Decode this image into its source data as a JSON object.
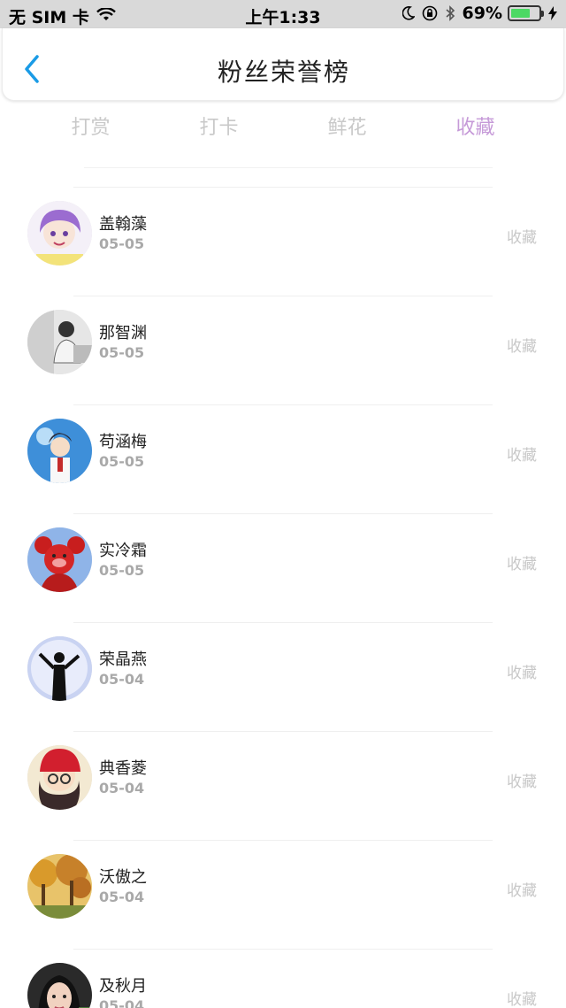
{
  "status_bar": {
    "carrier": "无 SIM 卡",
    "time": "上午1:33",
    "battery": "69%",
    "battery_level": 0.69
  },
  "header": {
    "title": "粉丝荣誉榜"
  },
  "tabs": [
    {
      "label": "打赏",
      "active": false
    },
    {
      "label": "打卡",
      "active": false
    },
    {
      "label": "鲜花",
      "active": false
    },
    {
      "label": "收藏",
      "active": true
    }
  ],
  "colors": {
    "active_tab": "#c69ad8",
    "inactive_tab": "#c9c9c9",
    "battery": "#4cd964",
    "back_arrow": "#1a9be6"
  },
  "fans": [
    {
      "name": "盖翰藻",
      "date": "05-05",
      "action": "收藏",
      "avatar": "anime-purple-hair-avatar"
    },
    {
      "name": "那智渊",
      "date": "05-05",
      "action": "收藏",
      "avatar": "grayscale-person-avatar"
    },
    {
      "name": "苟涵梅",
      "date": "05-05",
      "action": "收藏",
      "avatar": "anime-boy-sky-avatar"
    },
    {
      "name": "实冷霜",
      "date": "05-05",
      "action": "收藏",
      "avatar": "red-plush-toy-avatar"
    },
    {
      "name": "荣晶燕",
      "date": "05-04",
      "action": "收藏",
      "avatar": "silhouette-moon-avatar"
    },
    {
      "name": "典香菱",
      "date": "05-04",
      "action": "收藏",
      "avatar": "anime-red-hat-avatar"
    },
    {
      "name": "沃傲之",
      "date": "05-04",
      "action": "收藏",
      "avatar": "autumn-trees-avatar"
    },
    {
      "name": "及秋月",
      "date": "05-04",
      "action": "收藏",
      "avatar": "woman-portrait-avatar"
    }
  ]
}
